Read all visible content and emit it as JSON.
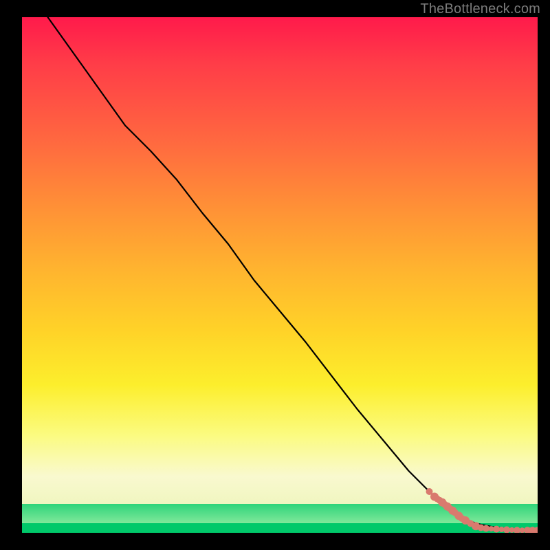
{
  "watermark": "TheBottleneck.com",
  "chart_data": {
    "type": "line",
    "title": "",
    "xlabel": "",
    "ylabel": "",
    "xlim": [
      0,
      100
    ],
    "ylim": [
      0,
      100
    ],
    "gradient_meaning": "vertical heat gradient from red (bottleneck) to green (optimal)",
    "series": [
      {
        "name": "bottleneck-curve",
        "x": [
          5,
          10,
          15,
          20,
          25,
          30,
          35,
          40,
          45,
          50,
          55,
          60,
          65,
          70,
          75,
          80,
          82.5,
          85,
          87,
          89,
          91,
          93,
          95,
          97,
          99,
          100
        ],
        "y": [
          100,
          93,
          86,
          79,
          74,
          68.5,
          62,
          56,
          49,
          43,
          37,
          30.5,
          24,
          18,
          12,
          7,
          5,
          3.2,
          2.2,
          1.6,
          1.2,
          0.9,
          0.7,
          0.6,
          0.5,
          0.5
        ]
      }
    ],
    "points": {
      "name": "data-points",
      "x": [
        79,
        80,
        80.5,
        81,
        81.5,
        82,
        82.5,
        83,
        83.5,
        84,
        84.7,
        85.3,
        86,
        87,
        88,
        89,
        90,
        91,
        92,
        93,
        94,
        95,
        96,
        97,
        98,
        98.5,
        99,
        99.5,
        100
      ],
      "y": [
        8,
        7,
        6.6,
        6.3,
        5.9,
        5.5,
        5.1,
        4.7,
        4.3,
        3.9,
        3.3,
        2.8,
        2.4,
        1.8,
        1.3,
        1.0,
        0.85,
        0.78,
        0.72,
        0.66,
        0.6,
        0.55,
        0.5,
        0.5,
        0.5,
        0.5,
        0.5,
        0.5,
        0.5
      ],
      "r": [
        5,
        6,
        5,
        5,
        6,
        5,
        6,
        5,
        6,
        5,
        6,
        5,
        6,
        5,
        6,
        5,
        5,
        4,
        5,
        4,
        5,
        4,
        5,
        4,
        5,
        4,
        5,
        4,
        5
      ]
    }
  }
}
